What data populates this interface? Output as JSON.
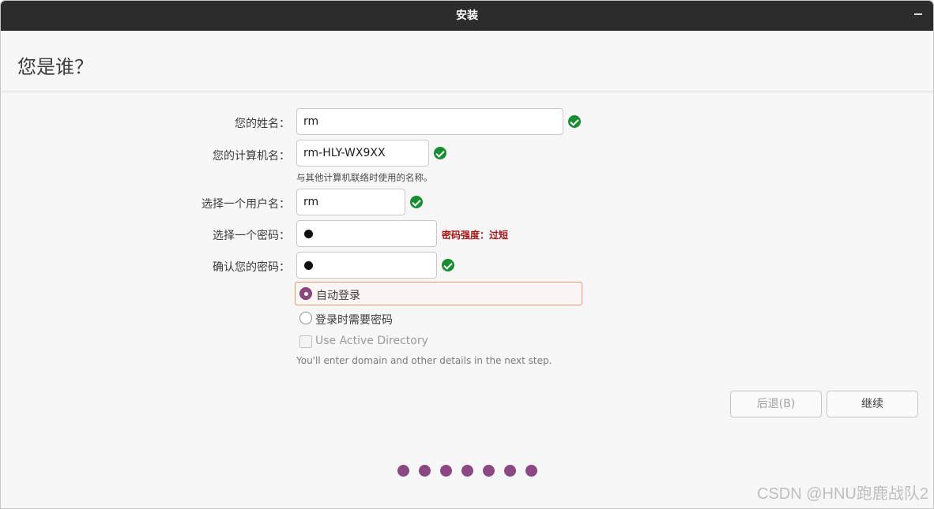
{
  "window": {
    "title": "安装"
  },
  "header": {
    "title": "您是谁？"
  },
  "form": {
    "name": {
      "label": "您的姓名：",
      "value": "rm"
    },
    "computer": {
      "label": "您的计算机名：",
      "value": "rm-HLY-WX9XX",
      "hint": "与其他计算机联络时使用的名称。"
    },
    "username": {
      "label": "选择一个用户名：",
      "value": "rm"
    },
    "password": {
      "label": "选择一个密码：",
      "strength": "密码强度：过短"
    },
    "confirm": {
      "label": "确认您的密码："
    }
  },
  "options": {
    "auto_login": "自动登录",
    "require_password": "登录时需要密码",
    "active_directory": "Use Active Directory",
    "ad_hint": "You'll enter domain and other details in the next step."
  },
  "buttons": {
    "back": "后退(B)",
    "continue": "继续"
  },
  "progress": {
    "total_steps": 7
  },
  "watermark": "CSDN @HNU跑鹿战队2",
  "colors": {
    "accent": "#8b4882",
    "ok": "#1a8c32",
    "warning": "#a31515",
    "focus": "#e9957a"
  }
}
